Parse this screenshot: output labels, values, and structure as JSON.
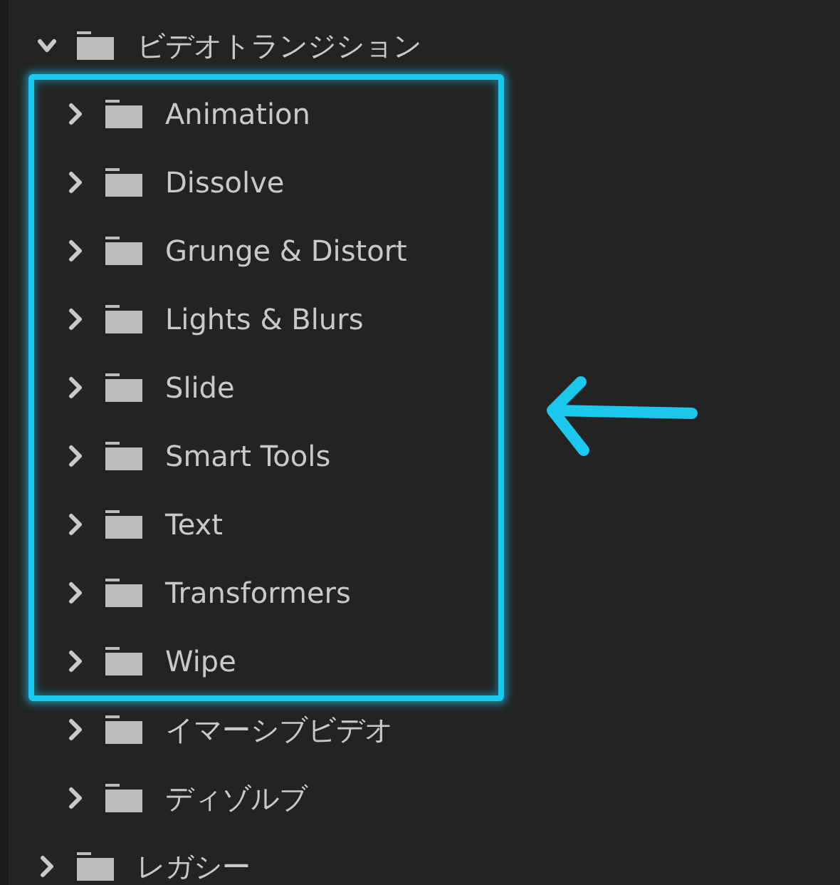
{
  "tree": [
    {
      "label": "ビデオトランジション",
      "expanded": true,
      "children": [
        {
          "kind": "highlight_group",
          "items": [
            {
              "label": "Animation",
              "expanded": false
            },
            {
              "label": "Dissolve",
              "expanded": false
            },
            {
              "label": "Grunge & Distort",
              "expanded": false
            },
            {
              "label": "Lights & Blurs",
              "expanded": false
            },
            {
              "label": "Slide",
              "expanded": false
            },
            {
              "label": "Smart Tools",
              "expanded": false
            },
            {
              "label": "Text",
              "expanded": false
            },
            {
              "label": "Transformers",
              "expanded": false
            },
            {
              "label": "Wipe",
              "expanded": false
            }
          ]
        },
        {
          "kind": "item",
          "label": "イマーシブビデオ",
          "expanded": false
        },
        {
          "kind": "item",
          "label": "ディゾルブ",
          "expanded": false
        }
      ]
    },
    {
      "label": "レガシー",
      "expanded": false
    }
  ],
  "callout": {
    "kind": "arrow"
  }
}
